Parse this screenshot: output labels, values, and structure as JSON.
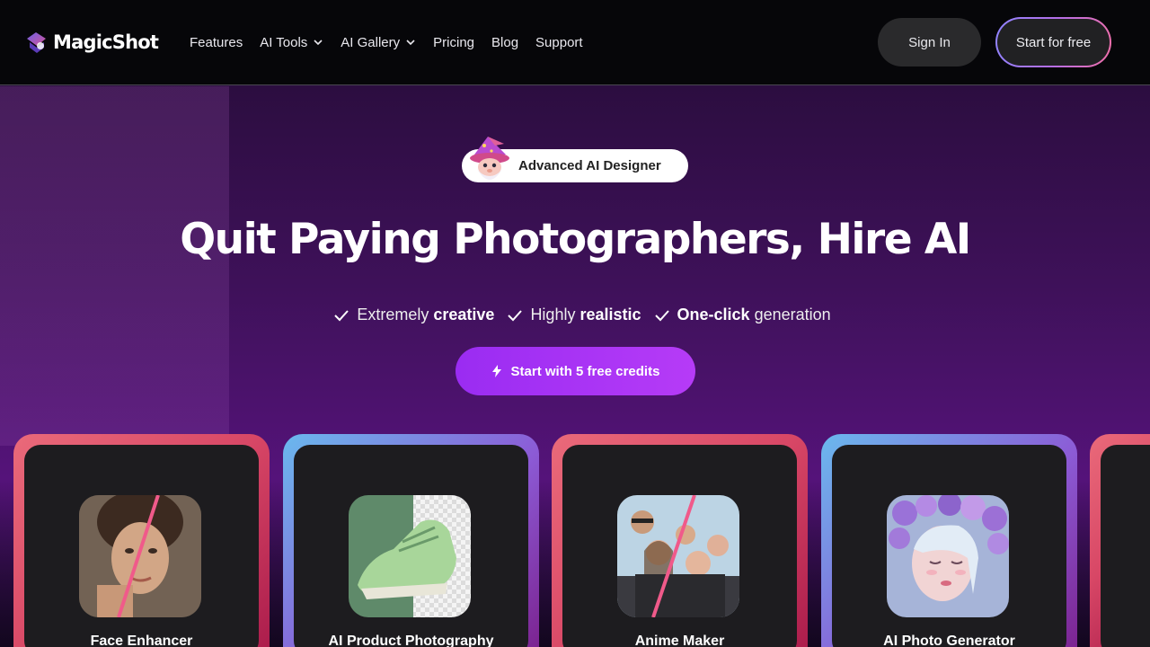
{
  "nav": {
    "logo_text": "MagicShot",
    "links": [
      {
        "label": "Features"
      },
      {
        "label": "AI Tools"
      },
      {
        "label": "AI Gallery"
      },
      {
        "label": "Pricing"
      },
      {
        "label": "Blog"
      },
      {
        "label": "Support"
      }
    ],
    "sign_in": "Sign In",
    "start_free": "Start for free"
  },
  "hero": {
    "badge": "Advanced AI Designer",
    "title": "Quit Paying Photographers, Hire AI",
    "features": [
      {
        "pre": "Extremely ",
        "bold": "creative",
        "post": ""
      },
      {
        "pre": "Highly ",
        "bold": "realistic",
        "post": ""
      },
      {
        "pre": "",
        "bold": "One-click",
        "post": " generation"
      }
    ],
    "cta": "Start with 5 free credits"
  },
  "cards": [
    {
      "label": "Face Enhancer"
    },
    {
      "label": "AI Product Photography"
    },
    {
      "label": "Anime Maker"
    },
    {
      "label": "AI Photo Generator"
    }
  ],
  "colors": {
    "accent": "#a433f5",
    "nav_bg": "#060609",
    "card_pink": "#d84766",
    "card_blue": "#6ab9ee"
  }
}
